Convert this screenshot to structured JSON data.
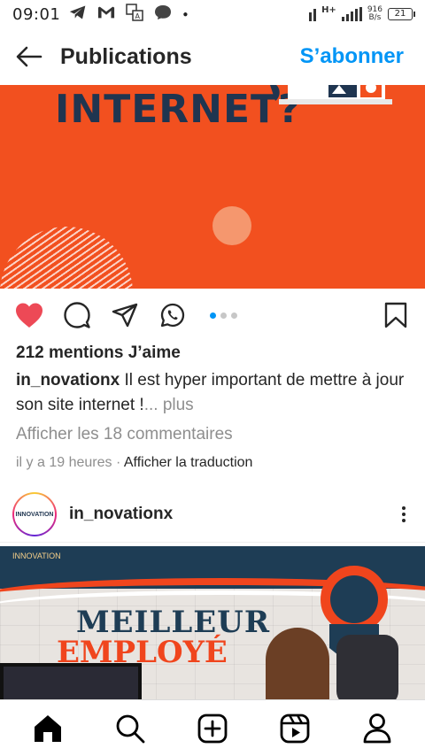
{
  "status_bar": {
    "time": "09:01",
    "network_speed": "916",
    "network_unit": "B/s",
    "network_type": "H+",
    "battery": "21",
    "notification_icons": [
      "telegram-icon",
      "gmail-icon",
      "translate-icon",
      "messenger-icon"
    ]
  },
  "header": {
    "title": "Publications",
    "follow_label": "S’abonner"
  },
  "post1": {
    "image_headline": "INTERNET?",
    "likes": "212 mentions J’aime",
    "username": "in_novationx",
    "caption": "Il est hyper important de mettre à jour son site internet !",
    "more": "... plus",
    "view_comments": "Afficher les 18 commentaires",
    "time_ago": "il y a 19 heures",
    "separator": " · ",
    "translate": "Afficher la traduction",
    "carousel_count": 3,
    "carousel_active": 0
  },
  "post2": {
    "username": "in_novationx",
    "avatar_text": "INNOVATION",
    "image_logo": "INNOVATION",
    "image_title_1": "MEILLEUR",
    "image_title_2": "EMPLOYÉ"
  },
  "colors": {
    "accent": "#0095f6",
    "like_red": "#ed4956",
    "post_orange": "#f2501f",
    "post_navy": "#1f3550"
  }
}
